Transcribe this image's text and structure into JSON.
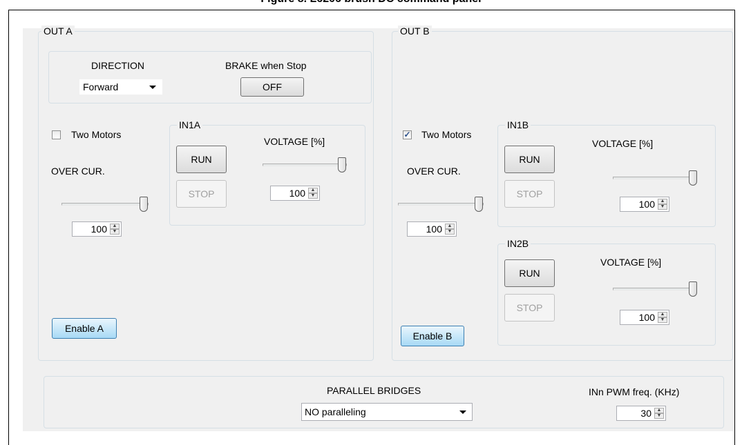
{
  "caption": "Figure 8. L6206 brush DC command panel",
  "out_a": {
    "title": "OUT A",
    "direction_label": "DIRECTION",
    "direction_value": "Forward",
    "brake_label": "BRAKE when Stop",
    "brake_button": "OFF",
    "two_motors_label": "Two Motors",
    "two_motors_checked": false,
    "over_cur_label": "OVER CUR.",
    "over_cur_value": "100",
    "in1a": {
      "title": "IN1A",
      "run": "RUN",
      "stop": "STOP",
      "voltage_label": "VOLTAGE [%]",
      "voltage_value": "100"
    },
    "enable_button": "Enable A"
  },
  "out_b": {
    "title": "OUT B",
    "two_motors_label": "Two Motors",
    "two_motors_checked": true,
    "check_mark": "✓",
    "over_cur_label": "OVER CUR.",
    "over_cur_value": "100",
    "in1b": {
      "title": "IN1B",
      "run": "RUN",
      "stop": "STOP",
      "voltage_label": "VOLTAGE [%]",
      "voltage_value": "100"
    },
    "in2b": {
      "title": "IN2B",
      "run": "RUN",
      "stop": "STOP",
      "voltage_label": "VOLTAGE [%]",
      "voltage_value": "100"
    },
    "enable_button": "Enable B"
  },
  "bottom": {
    "parallel_label": "PARALLEL BRIDGES",
    "parallel_value": "NO paralleling",
    "pwm_label": "INn PWM freq. (KHz)",
    "pwm_value": "30"
  },
  "sliders": {
    "over_cur_a": 1.0,
    "voltage_in1a": 1.0,
    "over_cur_b": 1.0,
    "voltage_in1b": 1.0,
    "voltage_in2b": 1.0
  },
  "colors": {
    "panel_bg": "#f0f0f0",
    "group_border": "#d5dfe5",
    "enable_button": "#a7d9f5"
  }
}
